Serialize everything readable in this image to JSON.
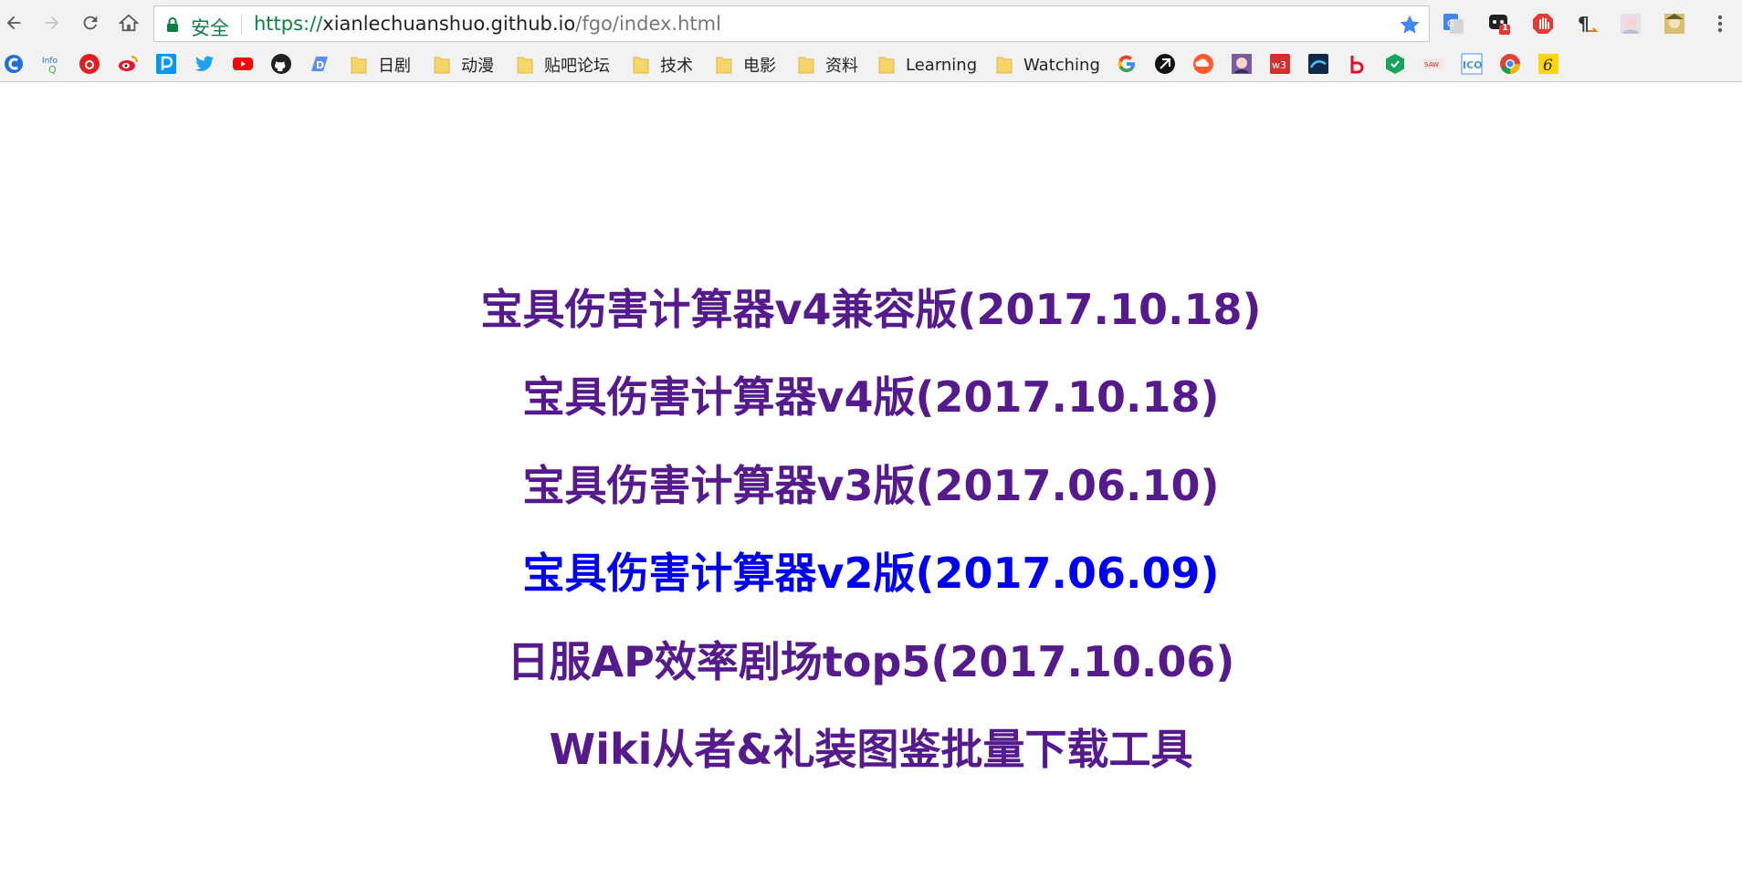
{
  "browser": {
    "security_label": "安全",
    "url": {
      "scheme": "https://",
      "host": "xianlechuanshuo.github.io",
      "path": "/fgo/index.html"
    },
    "extension_badge": "1",
    "bookmarks_folders": [
      "日剧",
      "动漫",
      "贴吧论坛",
      "技术",
      "电影",
      "资料",
      "Learning",
      "Watching"
    ]
  },
  "page": {
    "links": [
      {
        "text": "宝具伤害计算器v4兼容版(2017.10.18)",
        "state": "visited"
      },
      {
        "text": "宝具伤害计算器v4版(2017.10.18)",
        "state": "visited"
      },
      {
        "text": "宝具伤害计算器v3版(2017.06.10)",
        "state": "visited"
      },
      {
        "text": "宝具伤害计算器v2版(2017.06.09)",
        "state": "unvisited"
      },
      {
        "text": "日服AP效率剧场top5(2017.10.06)",
        "state": "visited"
      },
      {
        "text": "Wiki从者&礼装图鉴批量下载工具",
        "state": "visited"
      }
    ]
  },
  "colors": {
    "visited_link": "#551a8b",
    "unvisited_link": "#0000ee",
    "secure_green": "#0b8043",
    "bookmark_star": "#4285f4"
  }
}
